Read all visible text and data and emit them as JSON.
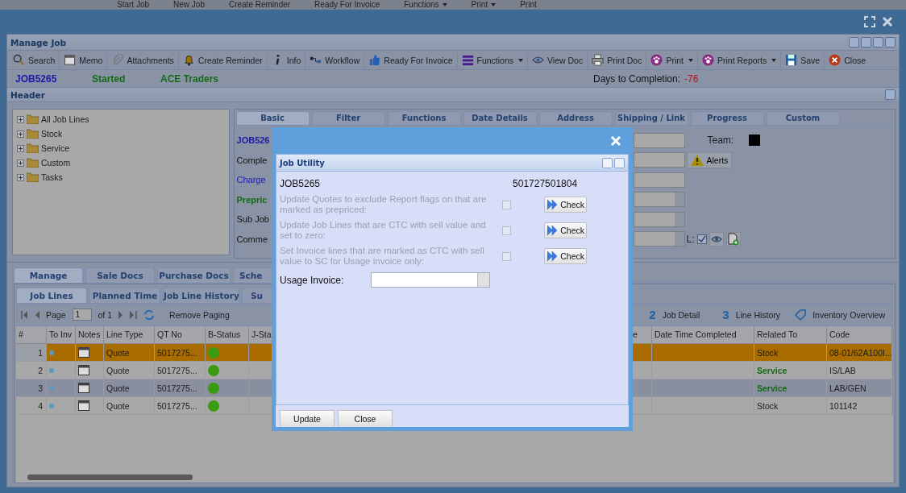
{
  "background_toolbar": [
    {
      "label": "Start Job",
      "dropdown": false
    },
    {
      "label": "New Job",
      "dropdown": false
    },
    {
      "label": "Create Reminder",
      "dropdown": false
    },
    {
      "label": "Ready For Invoice",
      "dropdown": false
    },
    {
      "label": "Functions",
      "dropdown": true
    },
    {
      "label": "Print",
      "dropdown": true
    },
    {
      "label": "Print",
      "dropdown": false
    }
  ],
  "panel": {
    "title": "Manage Job"
  },
  "toolbar": [
    {
      "label": "Search",
      "kind": "search",
      "dropdown": false
    },
    {
      "label": "Memo",
      "kind": "calendar",
      "dropdown": false
    },
    {
      "label": "Attachments",
      "kind": "clip",
      "dropdown": false
    },
    {
      "label": "Create Reminder",
      "kind": "bell",
      "dropdown": false
    },
    {
      "label": "Info",
      "kind": "info",
      "dropdown": false
    },
    {
      "label": "Workflow",
      "kind": "workflow",
      "dropdown": false
    },
    {
      "label": "Ready For Invoice",
      "kind": "thumb",
      "dropdown": false
    },
    {
      "label": "Functions",
      "kind": "menu",
      "dropdown": true
    },
    {
      "label": "View Doc",
      "kind": "eye",
      "dropdown": false
    },
    {
      "label": "Print Doc",
      "kind": "printer",
      "dropdown": false
    },
    {
      "label": "Print",
      "kind": "paw",
      "dropdown": true
    },
    {
      "label": "Print Reports",
      "kind": "paw",
      "dropdown": true
    },
    {
      "label": "Save",
      "kind": "save",
      "dropdown": false
    },
    {
      "label": "Close",
      "kind": "close",
      "dropdown": false
    }
  ],
  "job_bar": {
    "job": "JOB5265",
    "status": "Started",
    "customer": "ACE Traders",
    "days_label": "Days to Completion:",
    "days_value": "-76"
  },
  "header": {
    "title": "Header"
  },
  "tree": [
    {
      "label": "All Job Lines",
      "expanded": false
    },
    {
      "label": "Stock",
      "expanded": false
    },
    {
      "label": "Service",
      "expanded": false
    },
    {
      "label": "Custom",
      "expanded": false
    },
    {
      "label": "Tasks",
      "expanded": false
    }
  ],
  "detail_tabs": [
    {
      "label": "Basic",
      "selected": true
    },
    {
      "label": "Filter",
      "selected": false
    },
    {
      "label": "Functions",
      "selected": false
    },
    {
      "label": "Date Details",
      "selected": false
    },
    {
      "label": "Address",
      "selected": false
    },
    {
      "label": "Shipping / Link",
      "selected": false
    },
    {
      "label": "Progress",
      "selected": false
    },
    {
      "label": "Custom",
      "selected": false
    }
  ],
  "form_labels": [
    {
      "text": "JOB526",
      "kind": "id"
    },
    {
      "text": "Comple",
      "kind": "plain"
    },
    {
      "text": "Charge",
      "kind": "link"
    },
    {
      "text": "Prepric",
      "kind": "accent"
    },
    {
      "text": "Sub Job",
      "kind": "plain"
    },
    {
      "text": "Comme",
      "kind": "plain"
    }
  ],
  "team_label": "Team:",
  "alerts_button": "Alerts",
  "l_label": "L:",
  "l_checked": true,
  "manage_tabs": [
    {
      "label": "Manage",
      "selected": true
    },
    {
      "label": "Sale Docs",
      "selected": false
    },
    {
      "label": "Purchase Docs",
      "selected": false
    },
    {
      "label": "Sche",
      "selected": false
    }
  ],
  "line_tabs": [
    {
      "label": "Job Lines",
      "selected": true
    },
    {
      "label": "Planned Time",
      "selected": false
    },
    {
      "label": "Job Line History",
      "selected": false
    },
    {
      "label": "Su",
      "selected": false
    }
  ],
  "pager": {
    "page_label": "Page",
    "page": "1",
    "of": "of 1",
    "remove_paging": "Remove Paging"
  },
  "grid_actions": [
    {
      "kind": "number",
      "number": "2",
      "label": "Job Detail"
    },
    {
      "kind": "number",
      "number": "3",
      "label": "Line History"
    },
    {
      "kind": "tag",
      "label": "Inventory Overview"
    }
  ],
  "grid": {
    "columns": [
      "#",
      "To Inv",
      "Notes",
      "Line Type",
      "QT No",
      "B-Status",
      "J-Sta",
      "e",
      "Date Time Completed",
      "Related To",
      "Code"
    ],
    "rows": [
      {
        "n": "1",
        "line_type": "Quote",
        "qt_no": "5017275...",
        "related_to": "Stock",
        "emphasized": false,
        "code": "08-01/62A100I...",
        "selected": true
      },
      {
        "n": "2",
        "line_type": "Quote",
        "qt_no": "5017275...",
        "related_to": "Service",
        "emphasized": true,
        "code": "IS/LAB",
        "selected": false
      },
      {
        "n": "3",
        "line_type": "Quote",
        "qt_no": "5017275...",
        "related_to": "Service",
        "emphasized": true,
        "code": "LAB/GEN",
        "selected": false
      },
      {
        "n": "4",
        "line_type": "Quote",
        "qt_no": "5017275...",
        "related_to": "Stock",
        "emphasized": false,
        "code": "101142",
        "selected": false
      }
    ]
  },
  "dialog": {
    "title": "Job Utility",
    "job": "JOB5265",
    "number": "501727501804",
    "options": [
      {
        "label": "Update Quotes to exclude Report flags on that are marked as prepriced:",
        "disabled": true,
        "checked": false,
        "button": "Check"
      },
      {
        "label": "Update Job Lines that are CTC with sell value and set to zero:",
        "disabled": true,
        "checked": false,
        "button": "Check"
      },
      {
        "label": "Set Invoice lines that are marked as CTC with sell value to SC for Usage invoice only:",
        "disabled": true,
        "checked": false,
        "button": "Check"
      }
    ],
    "usage_label": "Usage Invoice:",
    "buttons": [
      "Update",
      "Close"
    ]
  }
}
